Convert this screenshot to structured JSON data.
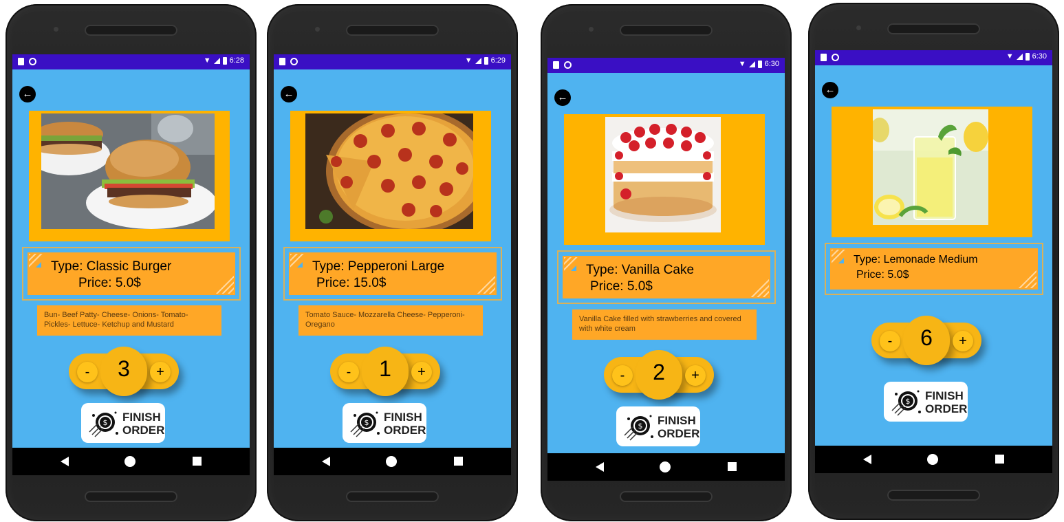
{
  "phones": [
    {
      "status": {
        "time": "6:28"
      },
      "item": {
        "type_line": "Type:  Classic Burger",
        "price_line": "Price:  5.0$",
        "description": "Bun- Beef Patty- Cheese- Onions- Tomato- Pickles- Lettuce- Ketchup and Mustard",
        "image_name": "classic-burger-photo"
      },
      "counter": {
        "minus": "-",
        "quantity": "3",
        "plus": "+"
      },
      "finish": {
        "line1": "FINISH",
        "line2": "ORDER"
      }
    },
    {
      "status": {
        "time": "6:29"
      },
      "item": {
        "type_line": "Type:  Pepperoni Large",
        "price_line": "Price:  15.0$",
        "description": "Tomato Sauce- Mozzarella Cheese- Pepperoni- Oregano",
        "image_name": "pepperoni-pizza-photo"
      },
      "counter": {
        "minus": "-",
        "quantity": "1",
        "plus": "+"
      },
      "finish": {
        "line1": "FINISH",
        "line2": "ORDER"
      }
    },
    {
      "status": {
        "time": "6:30"
      },
      "item": {
        "type_line": "Type:  Vanilla Cake",
        "price_line": "Price:  5.0$",
        "description": "Vanilla Cake filled with strawberries and covered with white cream",
        "image_name": "vanilla-cake-photo"
      },
      "counter": {
        "minus": "-",
        "quantity": "2",
        "plus": "+"
      },
      "finish": {
        "line1": "FINISH",
        "line2": "ORDER"
      }
    },
    {
      "status": {
        "time": "6:30"
      },
      "item": {
        "type_line": "Type:  Lemonade Medium",
        "price_line": "Price:  5.0$",
        "description": "",
        "image_name": "lemonade-photo"
      },
      "counter": {
        "minus": "-",
        "quantity": "6",
        "plus": "+"
      },
      "finish": {
        "line1": "FINISH",
        "line2": "ORDER"
      }
    }
  ],
  "colors": {
    "screen_bg": "#4fb3f0",
    "status_bar": "#3a0fc4",
    "image_frame": "#ffb300",
    "info_box": "#ffa726",
    "counter": "#f7b515"
  }
}
